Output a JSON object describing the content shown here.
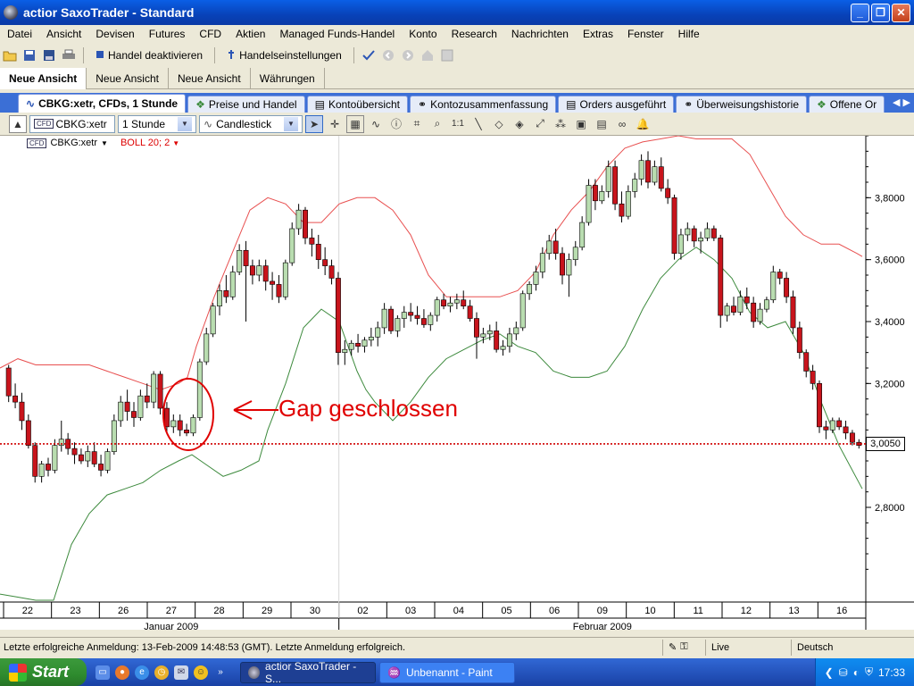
{
  "window": {
    "title": "actior SaxoTrader - Standard",
    "buttons": [
      "_",
      "❐",
      "✕"
    ]
  },
  "menu": [
    "Datei",
    "Ansicht",
    "Devisen",
    "Futures",
    "CFD",
    "Aktien",
    "Managed Funds-Handel",
    "Konto",
    "Research",
    "Nachrichten",
    "Extras",
    "Fenster",
    "Hilfe"
  ],
  "toolbar": {
    "deactivate_label": "Handel deaktivieren",
    "settings_label": "Handelseinstellungen"
  },
  "view_tabs": [
    "Neue Ansicht",
    "Neue Ansicht",
    "Neue Ansicht",
    "Währungen"
  ],
  "doc_tabs": [
    {
      "label": "CBKG:xetr, CFDs, 1 Stunde",
      "icon": "chart-icon"
    },
    {
      "label": "Preise und Handel",
      "icon": "prices-icon"
    },
    {
      "label": "Kontoübersicht",
      "icon": "document-icon"
    },
    {
      "label": "Kontozusammenfassung",
      "icon": "summary-icon"
    },
    {
      "label": "Orders ausgeführt",
      "icon": "document-icon"
    },
    {
      "label": "Überweisungshistorie",
      "icon": "history-icon"
    },
    {
      "label": "Offene Or",
      "icon": "orders-icon"
    }
  ],
  "chart_toolbar": {
    "instrument": "CBKG:xetr",
    "interval": "1 Stunde",
    "chart_type": "Candlestick"
  },
  "legend": {
    "instrument": "CBKG:xetr",
    "indicator": "BOLL 20; 2"
  },
  "annotation": "Gap geschlossen",
  "chart_data": {
    "type": "candlestick",
    "yticks": [
      "3,8000",
      "3,6000",
      "3,4000",
      "3,2000",
      "2,8000"
    ],
    "ylim": [
      2.8,
      4.0
    ],
    "current_price": 3.005,
    "current_price_label": "3,0050",
    "xticks": [
      "22",
      "23",
      "26",
      "27",
      "28",
      "29",
      "30",
      "02",
      "03",
      "04",
      "05",
      "06",
      "09",
      "10",
      "11",
      "12",
      "13",
      "16"
    ],
    "month_labels": [
      "Januar 2009",
      "Februar 2009"
    ],
    "candles": [
      [
        3.25,
        3.26,
        3.14,
        3.16
      ],
      [
        3.16,
        3.2,
        3.12,
        3.14
      ],
      [
        3.14,
        3.17,
        3.05,
        3.08
      ],
      [
        3.08,
        3.1,
        2.99,
        3.0
      ],
      [
        3.0,
        3.01,
        2.88,
        2.9
      ],
      [
        2.9,
        2.95,
        2.88,
        2.94
      ],
      [
        2.94,
        2.96,
        2.9,
        2.92
      ],
      [
        2.92,
        3.02,
        2.91,
        3.0
      ],
      [
        3.0,
        3.08,
        2.98,
        3.02
      ],
      [
        3.02,
        3.04,
        2.97,
        2.99
      ],
      [
        2.99,
        3.01,
        2.94,
        2.97
      ],
      [
        2.97,
        2.99,
        2.94,
        2.95
      ],
      [
        2.95,
        3.0,
        2.93,
        2.98
      ],
      [
        2.98,
        3.01,
        2.93,
        2.94
      ],
      [
        2.94,
        2.97,
        2.9,
        2.92
      ],
      [
        2.92,
        2.99,
        2.91,
        2.98
      ],
      [
        2.98,
        3.1,
        2.97,
        3.08
      ],
      [
        3.08,
        3.16,
        3.06,
        3.14
      ],
      [
        3.14,
        3.18,
        3.08,
        3.11
      ],
      [
        3.11,
        3.14,
        3.06,
        3.09
      ],
      [
        3.09,
        3.18,
        3.08,
        3.16
      ],
      [
        3.16,
        3.2,
        3.12,
        3.14
      ],
      [
        3.14,
        3.24,
        3.12,
        3.23
      ],
      [
        3.23,
        3.24,
        3.1,
        3.12
      ],
      [
        3.12,
        3.14,
        3.04,
        3.06
      ],
      [
        3.06,
        3.1,
        3.04,
        3.08
      ],
      [
        3.08,
        3.1,
        3.03,
        3.05
      ],
      [
        3.05,
        3.07,
        3.03,
        3.04
      ],
      [
        3.04,
        3.1,
        3.03,
        3.09
      ],
      [
        3.09,
        3.28,
        3.08,
        3.27
      ],
      [
        3.27,
        3.38,
        3.26,
        3.36
      ],
      [
        3.36,
        3.46,
        3.35,
        3.45
      ],
      [
        3.45,
        3.52,
        3.42,
        3.5
      ],
      [
        3.5,
        3.55,
        3.46,
        3.48
      ],
      [
        3.48,
        3.58,
        3.47,
        3.56
      ],
      [
        3.56,
        3.65,
        3.55,
        3.63
      ],
      [
        3.63,
        3.66,
        3.4,
        3.58
      ],
      [
        3.58,
        3.6,
        3.52,
        3.55
      ],
      [
        3.55,
        3.6,
        3.53,
        3.58
      ],
      [
        3.58,
        3.6,
        3.5,
        3.53
      ],
      [
        3.53,
        3.56,
        3.47,
        3.52
      ],
      [
        3.52,
        3.55,
        3.46,
        3.48
      ],
      [
        3.48,
        3.6,
        3.47,
        3.59
      ],
      [
        3.59,
        3.72,
        3.58,
        3.7
      ],
      [
        3.7,
        3.78,
        3.68,
        3.76
      ],
      [
        3.76,
        3.77,
        3.65,
        3.67
      ],
      [
        3.67,
        3.7,
        3.61,
        3.65
      ],
      [
        3.65,
        3.68,
        3.57,
        3.6
      ],
      [
        3.6,
        3.64,
        3.55,
        3.58
      ],
      [
        3.58,
        3.6,
        3.52,
        3.54
      ],
      [
        3.54,
        3.56,
        3.26,
        3.3
      ],
      [
        3.3,
        3.34,
        3.26,
        3.31
      ],
      [
        3.31,
        3.34,
        3.29,
        3.33
      ],
      [
        3.33,
        3.36,
        3.3,
        3.32
      ],
      [
        3.32,
        3.35,
        3.3,
        3.34
      ],
      [
        3.34,
        3.38,
        3.32,
        3.35
      ],
      [
        3.35,
        3.4,
        3.32,
        3.38
      ],
      [
        3.38,
        3.46,
        3.36,
        3.44
      ],
      [
        3.44,
        3.45,
        3.36,
        3.37
      ],
      [
        3.37,
        3.42,
        3.35,
        3.41
      ],
      [
        3.41,
        3.45,
        3.38,
        3.43
      ],
      [
        3.43,
        3.46,
        3.4,
        3.42
      ],
      [
        3.42,
        3.45,
        3.39,
        3.41
      ],
      [
        3.41,
        3.44,
        3.38,
        3.39
      ],
      [
        3.39,
        3.43,
        3.37,
        3.42
      ],
      [
        3.42,
        3.48,
        3.4,
        3.47
      ],
      [
        3.47,
        3.49,
        3.44,
        3.45
      ],
      [
        3.45,
        3.48,
        3.43,
        3.46
      ],
      [
        3.46,
        3.49,
        3.44,
        3.47
      ],
      [
        3.47,
        3.5,
        3.44,
        3.45
      ],
      [
        3.45,
        3.47,
        3.4,
        3.41
      ],
      [
        3.41,
        3.43,
        3.28,
        3.35
      ],
      [
        3.35,
        3.38,
        3.33,
        3.36
      ],
      [
        3.36,
        3.39,
        3.34,
        3.37
      ],
      [
        3.37,
        3.4,
        3.3,
        3.31
      ],
      [
        3.31,
        3.34,
        3.29,
        3.32
      ],
      [
        3.32,
        3.38,
        3.3,
        3.36
      ],
      [
        3.36,
        3.4,
        3.34,
        3.38
      ],
      [
        3.38,
        3.5,
        3.37,
        3.49
      ],
      [
        3.49,
        3.53,
        3.47,
        3.52
      ],
      [
        3.52,
        3.58,
        3.5,
        3.56
      ],
      [
        3.56,
        3.64,
        3.54,
        3.62
      ],
      [
        3.62,
        3.68,
        3.6,
        3.66
      ],
      [
        3.66,
        3.7,
        3.6,
        3.62
      ],
      [
        3.62,
        3.64,
        3.52,
        3.55
      ],
      [
        3.55,
        3.62,
        3.48,
        3.6
      ],
      [
        3.6,
        3.66,
        3.58,
        3.64
      ],
      [
        3.64,
        3.74,
        3.63,
        3.72
      ],
      [
        3.72,
        3.86,
        3.71,
        3.84
      ],
      [
        3.84,
        3.86,
        3.76,
        3.79
      ],
      [
        3.79,
        3.84,
        3.78,
        3.82
      ],
      [
        3.82,
        3.92,
        3.8,
        3.9
      ],
      [
        3.9,
        3.92,
        3.76,
        3.78
      ],
      [
        3.78,
        3.82,
        3.72,
        3.74
      ],
      [
        3.74,
        3.84,
        3.73,
        3.82
      ],
      [
        3.82,
        3.88,
        3.8,
        3.86
      ],
      [
        3.86,
        3.94,
        3.84,
        3.92
      ],
      [
        3.92,
        3.95,
        3.83,
        3.85
      ],
      [
        3.85,
        3.92,
        3.84,
        3.9
      ],
      [
        3.9,
        3.93,
        3.82,
        3.83
      ],
      [
        3.83,
        3.86,
        3.78,
        3.8
      ],
      [
        3.8,
        3.81,
        3.6,
        3.62
      ],
      [
        3.62,
        3.7,
        3.6,
        3.68
      ],
      [
        3.68,
        3.72,
        3.66,
        3.7
      ],
      [
        3.7,
        3.71,
        3.64,
        3.66
      ],
      [
        3.66,
        3.69,
        3.62,
        3.67
      ],
      [
        3.67,
        3.72,
        3.66,
        3.7
      ],
      [
        3.7,
        3.71,
        3.66,
        3.67
      ],
      [
        3.67,
        3.68,
        3.38,
        3.42
      ],
      [
        3.42,
        3.46,
        3.4,
        3.45
      ],
      [
        3.45,
        3.48,
        3.42,
        3.43
      ],
      [
        3.43,
        3.5,
        3.42,
        3.48
      ],
      [
        3.48,
        3.51,
        3.44,
        3.46
      ],
      [
        3.46,
        3.48,
        3.38,
        3.4
      ],
      [
        3.4,
        3.46,
        3.39,
        3.44
      ],
      [
        3.44,
        3.48,
        3.43,
        3.47
      ],
      [
        3.47,
        3.58,
        3.46,
        3.56
      ],
      [
        3.56,
        3.57,
        3.52,
        3.54
      ],
      [
        3.54,
        3.56,
        3.46,
        3.48
      ],
      [
        3.48,
        3.5,
        3.36,
        3.38
      ],
      [
        3.38,
        3.4,
        3.28,
        3.3
      ],
      [
        3.3,
        3.31,
        3.22,
        3.24
      ],
      [
        3.24,
        3.26,
        3.18,
        3.2
      ],
      [
        3.2,
        3.21,
        3.04,
        3.06
      ],
      [
        3.06,
        3.08,
        3.02,
        3.05
      ],
      [
        3.05,
        3.09,
        3.04,
        3.08
      ],
      [
        3.08,
        3.09,
        3.05,
        3.06
      ],
      [
        3.06,
        3.08,
        3.02,
        3.04
      ],
      [
        3.04,
        3.05,
        3.0,
        3.01
      ],
      [
        3.01,
        3.02,
        2.99,
        3.0
      ]
    ],
    "bollinger": {
      "upper": [
        [
          0,
          3.25
        ],
        [
          20,
          3.28
        ],
        [
          40,
          3.26
        ],
        [
          60,
          3.26
        ],
        [
          80,
          3.26
        ],
        [
          100,
          3.26
        ],
        [
          120,
          3.24
        ],
        [
          140,
          3.22
        ],
        [
          160,
          3.2
        ],
        [
          180,
          3.18
        ],
        [
          200,
          3.2
        ],
        [
          210,
          3.22
        ],
        [
          220,
          3.32
        ],
        [
          240,
          3.48
        ],
        [
          260,
          3.62
        ],
        [
          280,
          3.76
        ],
        [
          300,
          3.8
        ],
        [
          320,
          3.78
        ],
        [
          340,
          3.72
        ],
        [
          360,
          3.72
        ],
        [
          380,
          3.78
        ],
        [
          400,
          3.8
        ],
        [
          420,
          3.8
        ],
        [
          440,
          3.76
        ],
        [
          460,
          3.68
        ],
        [
          480,
          3.55
        ],
        [
          500,
          3.48
        ],
        [
          520,
          3.48
        ],
        [
          540,
          3.48
        ],
        [
          560,
          3.48
        ],
        [
          580,
          3.5
        ],
        [
          600,
          3.56
        ],
        [
          620,
          3.68
        ],
        [
          640,
          3.76
        ],
        [
          660,
          3.82
        ],
        [
          680,
          3.9
        ],
        [
          700,
          3.96
        ],
        [
          720,
          3.98
        ],
        [
          740,
          3.99
        ],
        [
          760,
          4.0
        ],
        [
          780,
          3.99
        ],
        [
          800,
          3.99
        ],
        [
          820,
          3.99
        ],
        [
          840,
          3.94
        ],
        [
          860,
          3.84
        ],
        [
          880,
          3.74
        ],
        [
          900,
          3.68
        ],
        [
          920,
          3.65
        ],
        [
          940,
          3.65
        ],
        [
          960,
          3.62
        ],
        [
          966,
          3.61
        ]
      ],
      "lower": [
        [
          0,
          2.52
        ],
        [
          20,
          2.51
        ],
        [
          40,
          2.5
        ],
        [
          60,
          2.5
        ],
        [
          80,
          2.68
        ],
        [
          100,
          2.78
        ],
        [
          120,
          2.84
        ],
        [
          140,
          2.86
        ],
        [
          160,
          2.88
        ],
        [
          180,
          2.92
        ],
        [
          200,
          2.95
        ],
        [
          215,
          2.97
        ],
        [
          230,
          2.94
        ],
        [
          250,
          2.9
        ],
        [
          270,
          2.92
        ],
        [
          290,
          2.95
        ],
        [
          300,
          3.05
        ],
        [
          320,
          3.2
        ],
        [
          340,
          3.38
        ],
        [
          360,
          3.44
        ],
        [
          380,
          3.4
        ],
        [
          400,
          3.24
        ],
        [
          410,
          3.18
        ],
        [
          420,
          3.14
        ],
        [
          440,
          3.08
        ],
        [
          460,
          3.14
        ],
        [
          480,
          3.22
        ],
        [
          500,
          3.28
        ],
        [
          520,
          3.31
        ],
        [
          540,
          3.34
        ],
        [
          560,
          3.36
        ],
        [
          580,
          3.32
        ],
        [
          600,
          3.3
        ],
        [
          620,
          3.24
        ],
        [
          640,
          3.22
        ],
        [
          660,
          3.22
        ],
        [
          680,
          3.24
        ],
        [
          700,
          3.32
        ],
        [
          720,
          3.44
        ],
        [
          740,
          3.54
        ],
        [
          760,
          3.6
        ],
        [
          780,
          3.64
        ],
        [
          800,
          3.6
        ],
        [
          820,
          3.54
        ],
        [
          840,
          3.43
        ],
        [
          860,
          3.38
        ],
        [
          880,
          3.4
        ],
        [
          900,
          3.3
        ],
        [
          920,
          3.14
        ],
        [
          940,
          3.0
        ],
        [
          966,
          2.86
        ]
      ]
    }
  },
  "status": {
    "message": "Letzte erfolgreiche Anmeldung: 13-Feb-2009 14:48:53 (GMT). Letzte Anmeldung erfolgreich.",
    "connection": "Live",
    "language": "Deutsch"
  },
  "taskbar": {
    "start_label": "Start",
    "tasks": [
      "actior SaxoTrader - S...",
      "Unbenannt - Paint"
    ],
    "clock": "17:33"
  },
  "colors": {
    "bull_candle": "#b9ddb0",
    "bear_candle": "#c8141c",
    "upper_band": "#e85050",
    "lower_band": "#3d8a3d",
    "price_line": "#d00000"
  }
}
